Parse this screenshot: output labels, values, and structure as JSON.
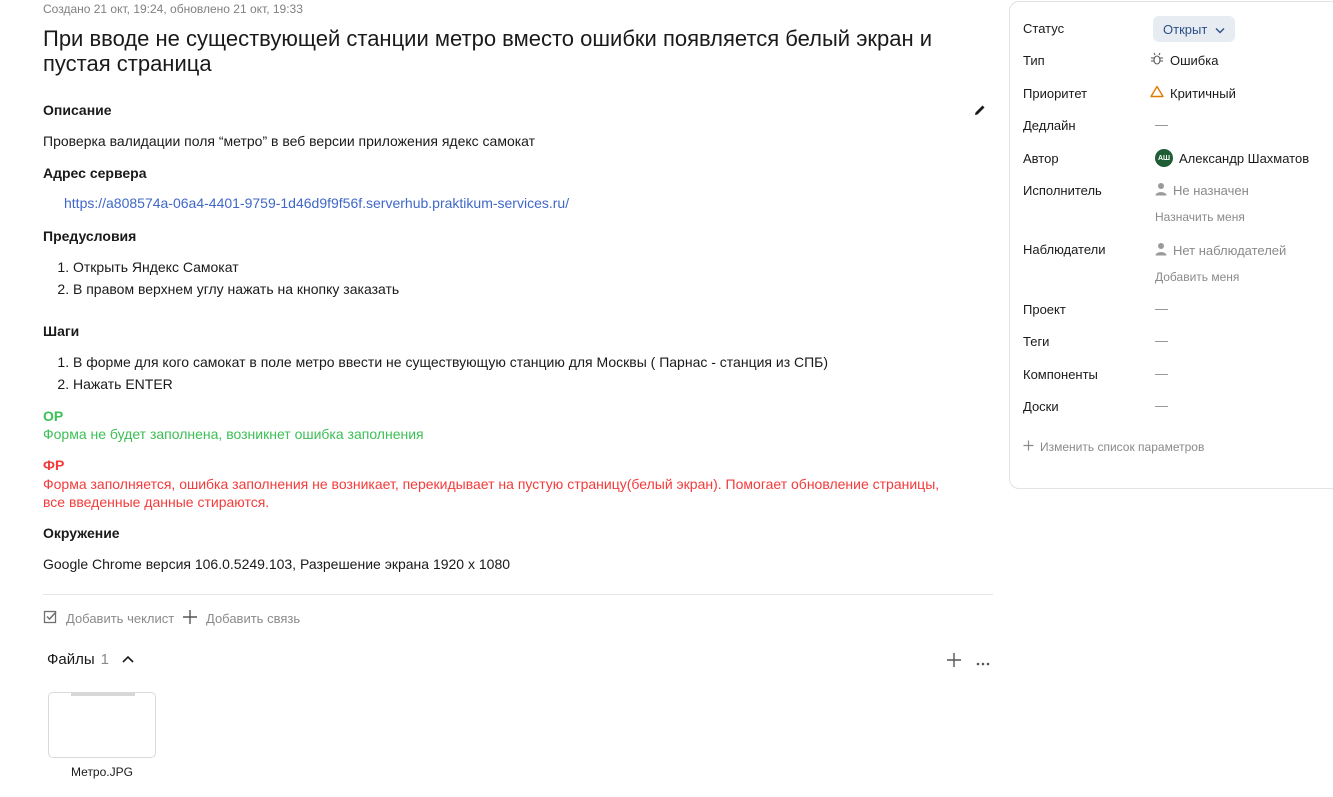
{
  "meta": "Создано 21 окт, 19:24, обновлено 21 окт, 19:33",
  "title": "При вводе не существующей станции метро вместо ошибки появляется белый экран и пустая страница",
  "description": {
    "heading": "Описание",
    "text": "Проверка валидации поля “метро” в веб версии приложения ядекс самокат"
  },
  "server": {
    "heading": "Адрес сервера",
    "url": "https://a808574a-06a4-4401-9759-1d46d9f9f56f.serverhub.praktikum-services.ru/"
  },
  "preconditions": {
    "heading": "Предусловия",
    "items": [
      "Открыть Яндекс Самокат",
      "В правом верхнем углу нажать на кнопку заказать"
    ]
  },
  "steps": {
    "heading": "Шаги",
    "items": [
      "В форме для кого самокат в поле метро ввести не существующую станцию для Москвы ( Парнас - станция из СПБ)",
      "Нажать ENTER"
    ]
  },
  "expected": {
    "heading": "ОР",
    "text": "Форма не будет заполнена, возникнет ошибка заполнения"
  },
  "actual": {
    "heading": "ФР",
    "text": "Форма заполняется, ошибка заполнения не возникает, перекидывает на пустую страницу(белый экран). Помогает обновление страницы, все введенные данные стираются."
  },
  "environment": {
    "heading": "Окружение",
    "text": "Google Chrome версия 106.0.5249.103, Разрешение экрана 1920 х 1080"
  },
  "actions": {
    "checklist": "Добавить чеклист",
    "link": "Добавить связь"
  },
  "files": {
    "title": "Файлы",
    "count": "1",
    "items": [
      {
        "name": "Метро.JPG"
      }
    ]
  },
  "sidebar": {
    "status_label": "Статус",
    "status_value": "Открыт",
    "type_label": "Тип",
    "type_value": "Ошибка",
    "priority_label": "Приоритет",
    "priority_value": "Критичный",
    "deadline_label": "Дедлайн",
    "deadline_value": "—",
    "author_label": "Автор",
    "author_initials": "АШ",
    "author_value": "Александр Шахматов",
    "assignee_label": "Исполнитель",
    "assignee_value": "Не назначен",
    "assign_me": "Назначить меня",
    "watchers_label": "Наблюдатели",
    "watchers_value": "Нет наблюдателей",
    "add_me": "Добавить меня",
    "project_label": "Проект",
    "project_value": "—",
    "tags_label": "Теги",
    "tags_value": "—",
    "components_label": "Компоненты",
    "components_value": "—",
    "boards_label": "Доски",
    "boards_value": "—",
    "change_params": "Изменить список параметров"
  },
  "colors": {
    "link": "#3f68c8",
    "expected": "#3cbf56",
    "actual": "#f33b3b",
    "priority_icon": "#e07b00",
    "avatar": "#1f5e35"
  },
  "icons": [
    "edit-icon",
    "checkbox-icon",
    "plus-icon",
    "chevron-up-icon",
    "more-icon",
    "chevron-down-icon",
    "bug-icon",
    "warning-triangle-icon",
    "user-icon"
  ]
}
